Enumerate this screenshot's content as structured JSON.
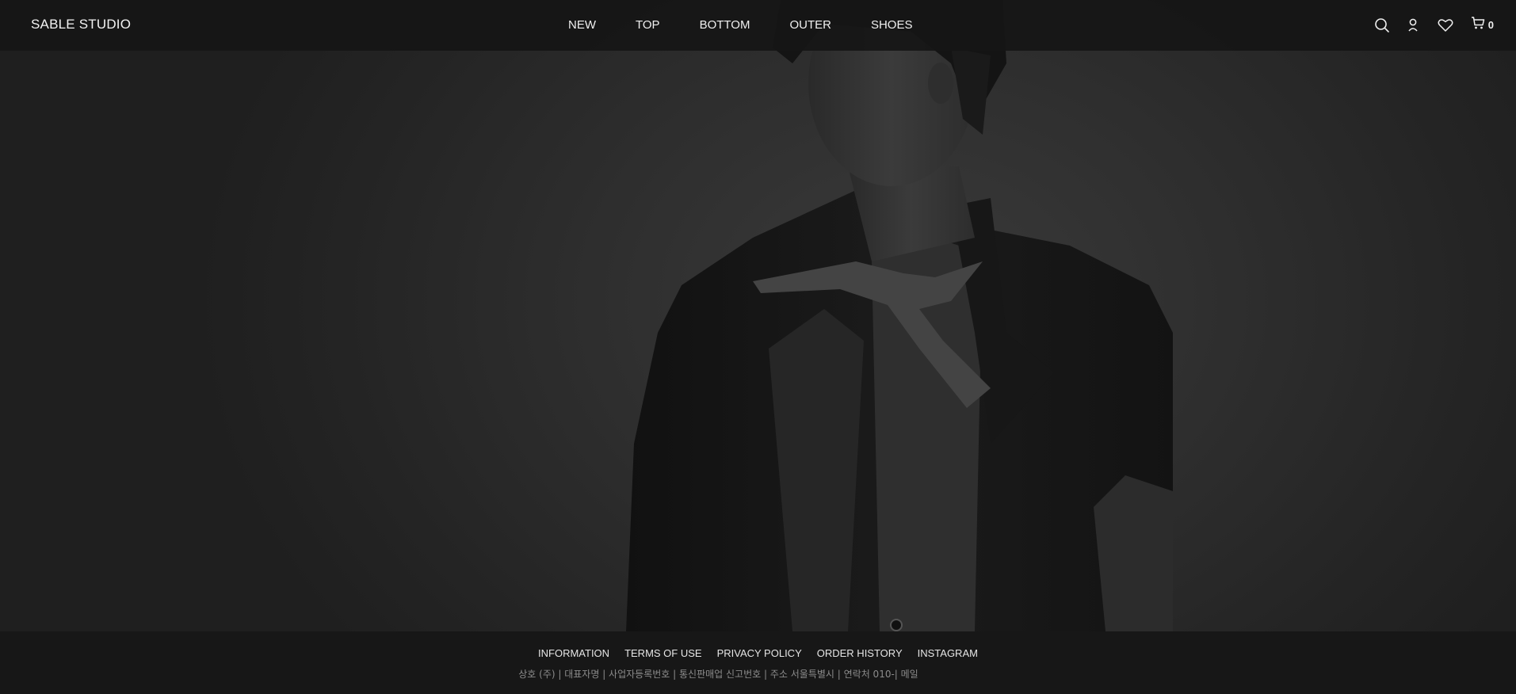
{
  "header": {
    "logo": "SABLE STUDIO",
    "nav": [
      {
        "label": "NEW"
      },
      {
        "label": "TOP"
      },
      {
        "label": "BOTTOM"
      },
      {
        "label": "OUTER"
      },
      {
        "label": "SHOES"
      }
    ],
    "icons": [
      "search-icon",
      "user-icon",
      "heart-icon",
      "cart-icon"
    ],
    "cart_count": "0"
  },
  "hero": {
    "description_icon": "hero-photo"
  },
  "footer": {
    "links": [
      {
        "label": "INFORMATION"
      },
      {
        "label": "TERMS OF USE"
      },
      {
        "label": "PRIVACY POLICY"
      },
      {
        "label": "ORDER HISTORY"
      },
      {
        "label": "INSTAGRAM"
      }
    ],
    "info": "상호 (주) | 대표자명 | 사업자등록번호 | 통신판매업 신고번호 | 주소 서울특별시 | 연락처 010-| 메일"
  },
  "colors": {
    "header_bg": "#161616",
    "footer_bg": "#171717",
    "text": "#f0f0f0",
    "muted": "#8c8c8c"
  }
}
